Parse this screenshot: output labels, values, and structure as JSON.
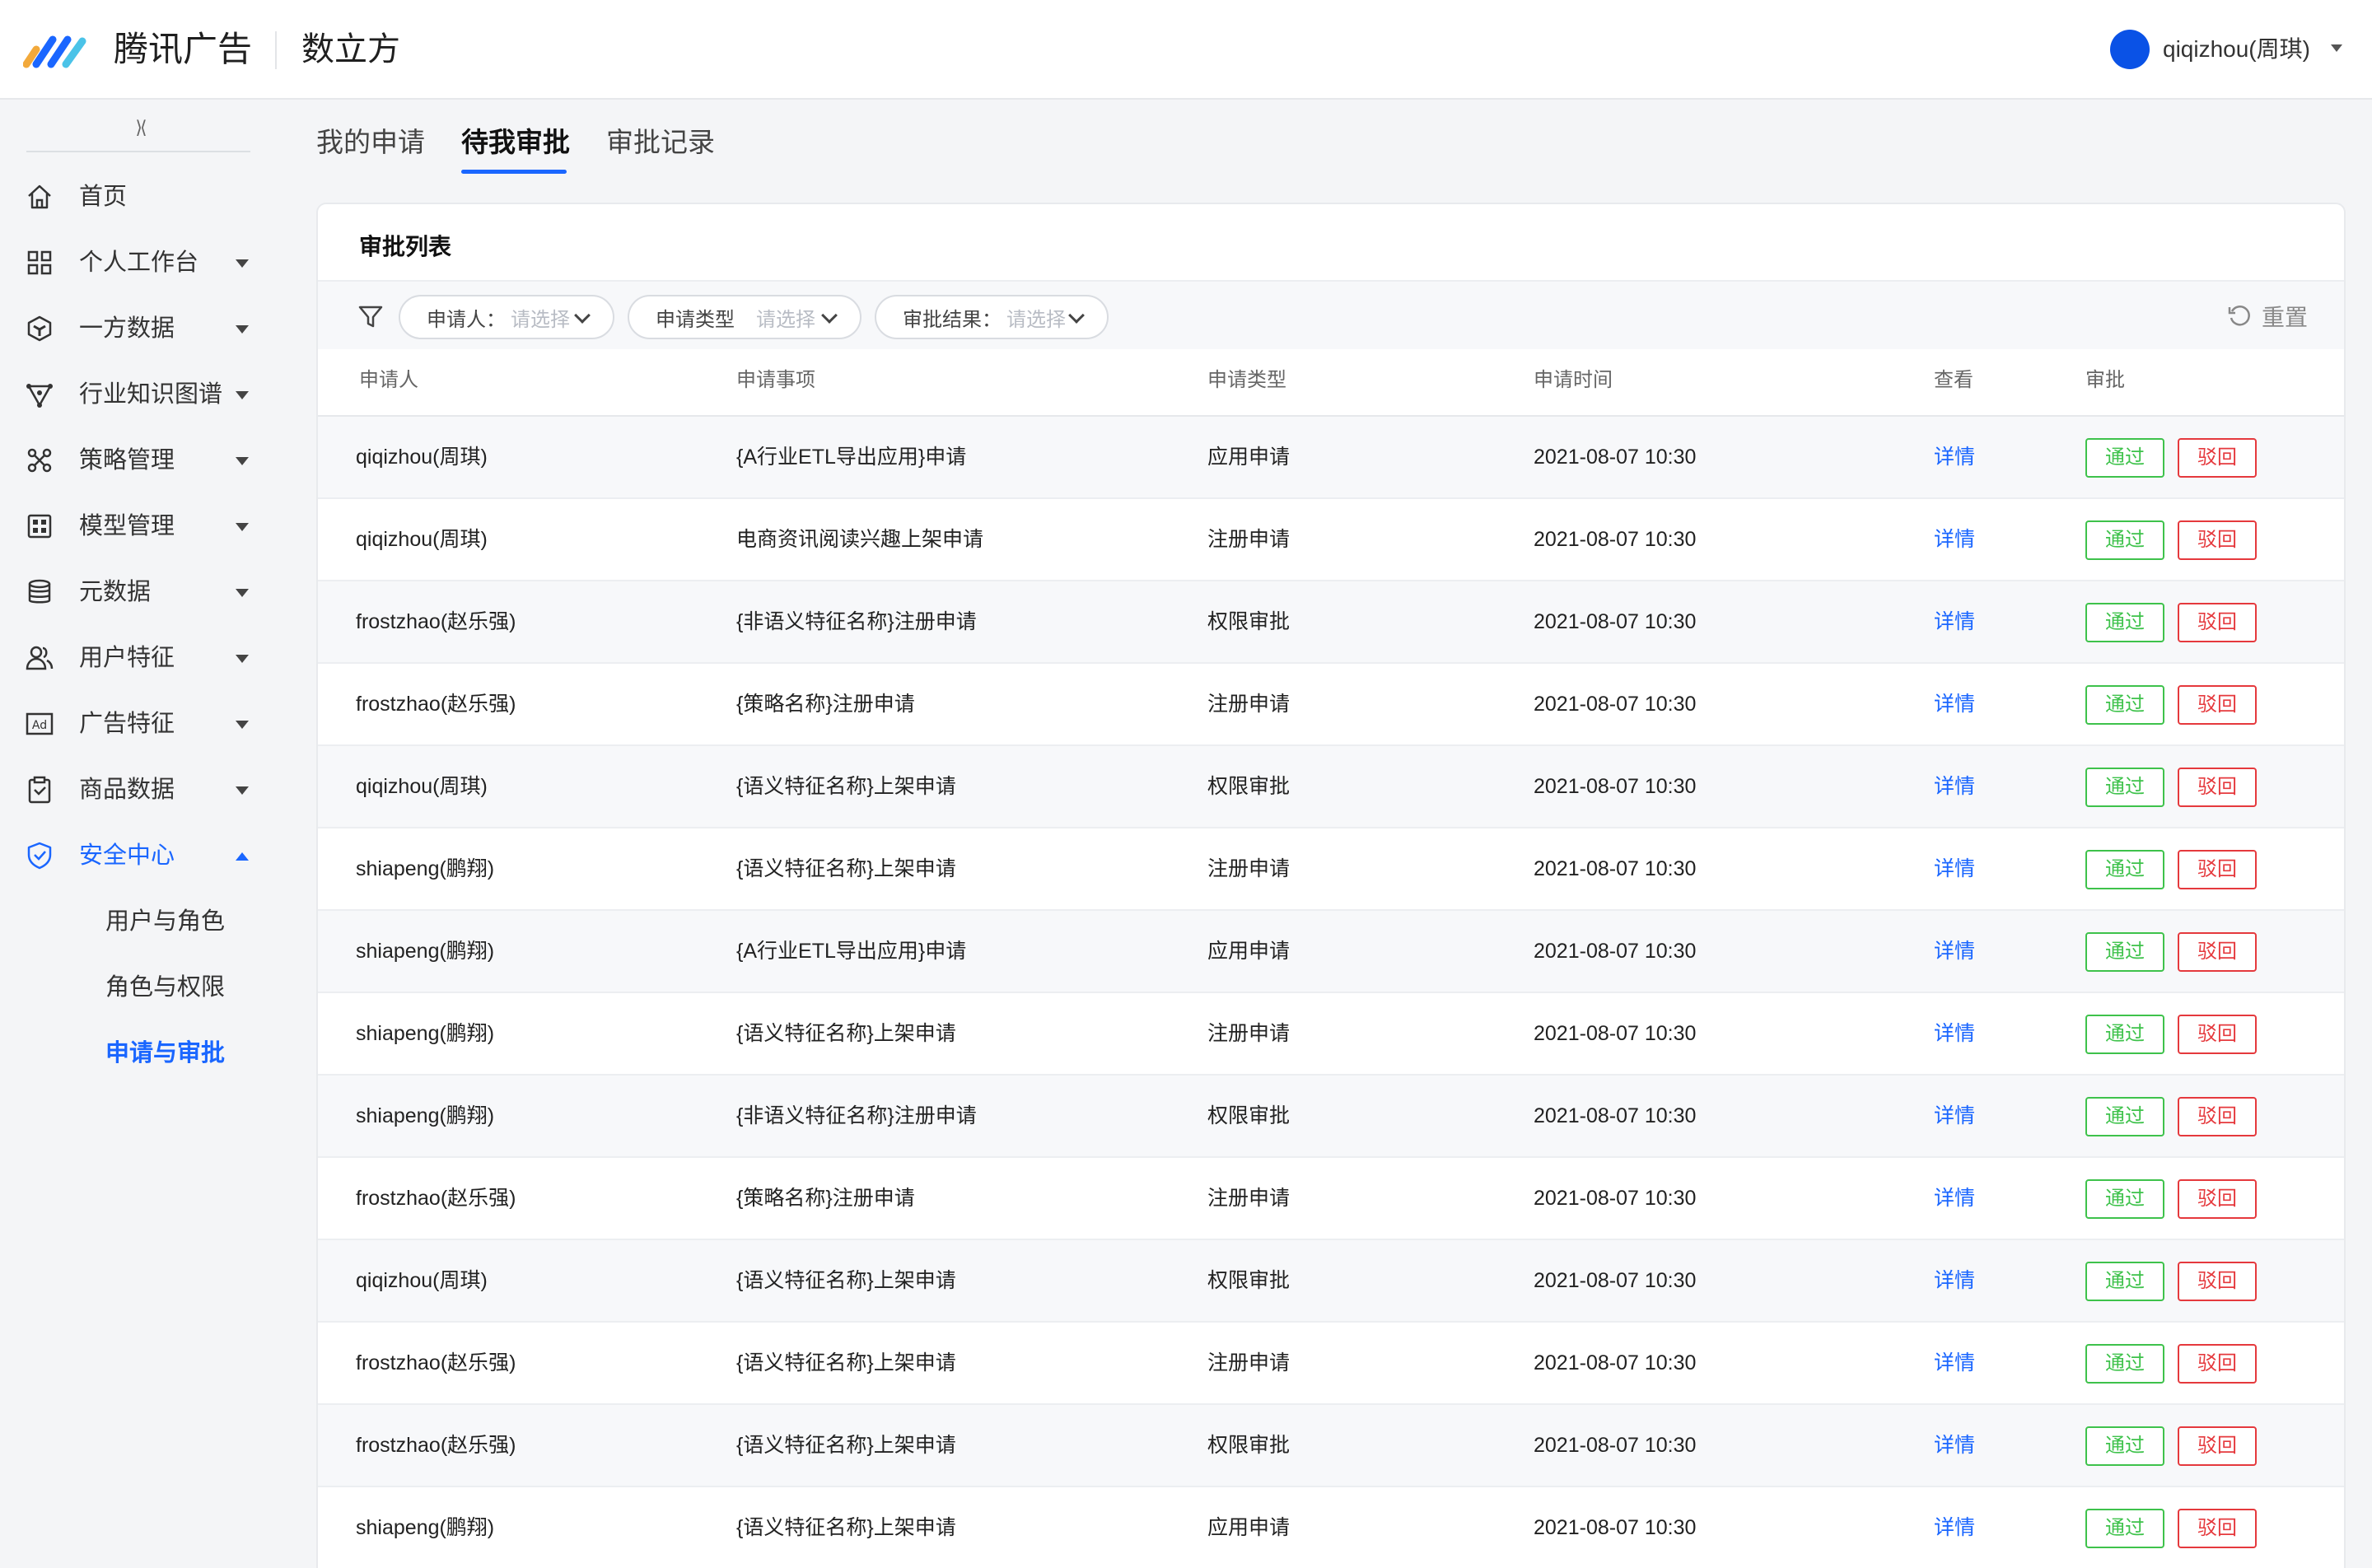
{
  "header": {
    "brand": "腾讯广告",
    "product": "数立方",
    "user_name": "qiqizhou(周琪)",
    "avatar_color": "#0a52e6"
  },
  "sidebar": {
    "collapse_glyph": "⟩⟨",
    "items": [
      {
        "label": "首页",
        "icon": "home-icon",
        "caret": "none"
      },
      {
        "label": "个人工作台",
        "icon": "grid-icon",
        "caret": "down"
      },
      {
        "label": "一方数据",
        "icon": "cube-icon",
        "caret": "down"
      },
      {
        "label": "行业知识图谱",
        "icon": "graph-icon",
        "caret": "down"
      },
      {
        "label": "策略管理",
        "icon": "strategy-icon",
        "caret": "down"
      },
      {
        "label": "模型管理",
        "icon": "model-icon",
        "caret": "down"
      },
      {
        "label": "元数据",
        "icon": "database-icon",
        "caret": "down"
      },
      {
        "label": "用户特征",
        "icon": "users-icon",
        "caret": "down"
      },
      {
        "label": "广告特征",
        "icon": "ad-icon",
        "caret": "down"
      },
      {
        "label": "商品数据",
        "icon": "clipboard-icon",
        "caret": "down"
      },
      {
        "label": "安全中心",
        "icon": "shield-icon",
        "caret": "up",
        "active": true
      }
    ],
    "sub_items": [
      {
        "label": "用户与角色"
      },
      {
        "label": "角色与权限"
      },
      {
        "label": "申请与审批",
        "active": true
      }
    ]
  },
  "tabs": [
    {
      "label": "我的申请"
    },
    {
      "label": "待我审批",
      "active": true
    },
    {
      "label": "审批记录"
    }
  ],
  "card": {
    "title": "审批列表",
    "filters": [
      {
        "label": "申请人：",
        "placeholder": "请选择"
      },
      {
        "label": "申请类型",
        "placeholder": "请选择"
      },
      {
        "label": "审批结果：",
        "placeholder": "请选择"
      }
    ],
    "reset_label": "重置"
  },
  "table": {
    "columns": [
      "申请人",
      "申请事项",
      "申请类型",
      "申请时间",
      "查看",
      "审批"
    ],
    "detail_label": "详情",
    "pass_label": "通过",
    "reject_label": "驳回",
    "rows": [
      {
        "applicant": "qiqizhou(周琪)",
        "item": "{A行业ETL导出应用}申请",
        "type": "应用申请",
        "time": "2021-08-07 10:30"
      },
      {
        "applicant": "qiqizhou(周琪)",
        "item": "电商资讯阅读兴趣上架申请",
        "type": "注册申请",
        "time": "2021-08-07 10:30"
      },
      {
        "applicant": "frostzhao(赵乐强)",
        "item": "{非语义特征名称}注册申请",
        "type": "权限审批",
        "time": "2021-08-07 10:30"
      },
      {
        "applicant": "frostzhao(赵乐强)",
        "item": "{策略名称}注册申请",
        "type": "注册申请",
        "time": "2021-08-07 10:30"
      },
      {
        "applicant": "qiqizhou(周琪)",
        "item": "{语义特征名称}上架申请",
        "type": "权限审批",
        "time": "2021-08-07 10:30"
      },
      {
        "applicant": "shiapeng(鹏翔)",
        "item": "{语义特征名称}上架申请",
        "type": "注册申请",
        "time": "2021-08-07 10:30"
      },
      {
        "applicant": "shiapeng(鹏翔)",
        "item": "{A行业ETL导出应用}申请",
        "type": "应用申请",
        "time": "2021-08-07 10:30"
      },
      {
        "applicant": "shiapeng(鹏翔)",
        "item": "{语义特征名称}上架申请",
        "type": "注册申请",
        "time": "2021-08-07 10:30"
      },
      {
        "applicant": "shiapeng(鹏翔)",
        "item": "{非语义特征名称}注册申请",
        "type": "权限审批",
        "time": "2021-08-07 10:30"
      },
      {
        "applicant": "frostzhao(赵乐强)",
        "item": "{策略名称}注册申请",
        "type": "注册申请",
        "time": "2021-08-07 10:30"
      },
      {
        "applicant": "qiqizhou(周琪)",
        "item": "{语义特征名称}上架申请",
        "type": "权限审批",
        "time": "2021-08-07 10:30"
      },
      {
        "applicant": "frostzhao(赵乐强)",
        "item": "{语义特征名称}上架申请",
        "type": "注册申请",
        "time": "2021-08-07 10:30"
      },
      {
        "applicant": "frostzhao(赵乐强)",
        "item": "{语义特征名称}上架申请",
        "type": "权限审批",
        "time": "2021-08-07 10:30"
      },
      {
        "applicant": "shiapeng(鹏翔)",
        "item": "{语义特征名称}上架申请",
        "type": "应用申请",
        "time": "2021-08-07 10:30"
      }
    ]
  },
  "colors": {
    "accent": "#1a66ff",
    "pass": "#3ec24b",
    "reject": "#e5393d"
  }
}
